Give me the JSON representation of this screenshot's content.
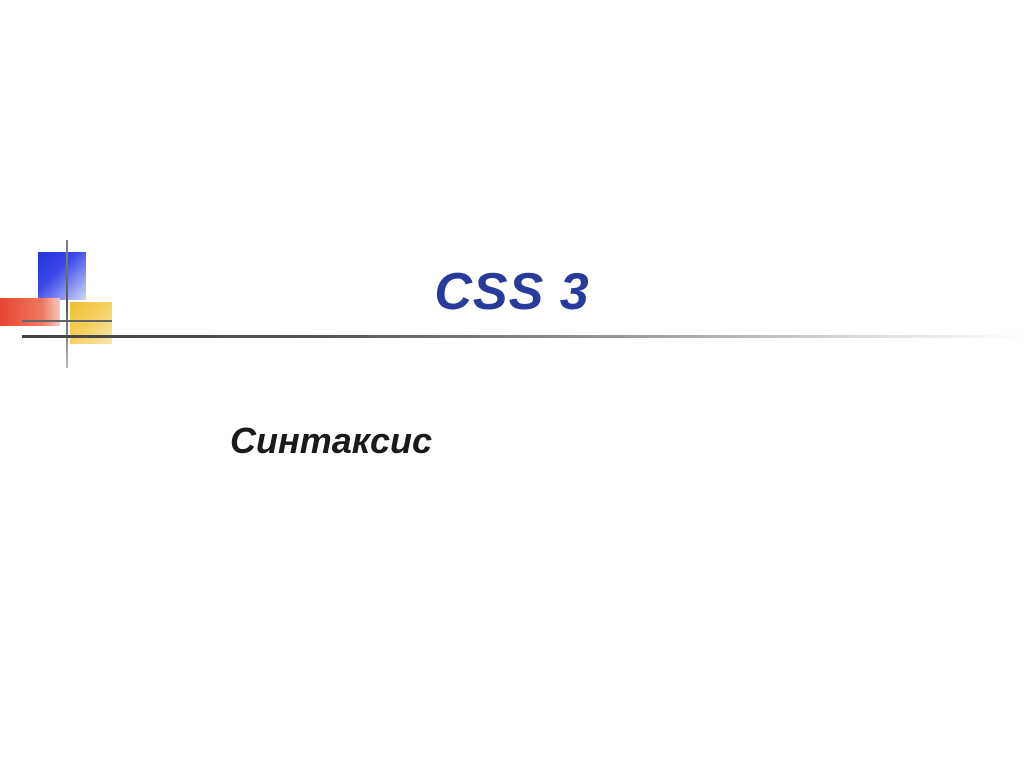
{
  "slide": {
    "title": "CSS 3",
    "subtitle": "Синтаксис"
  }
}
